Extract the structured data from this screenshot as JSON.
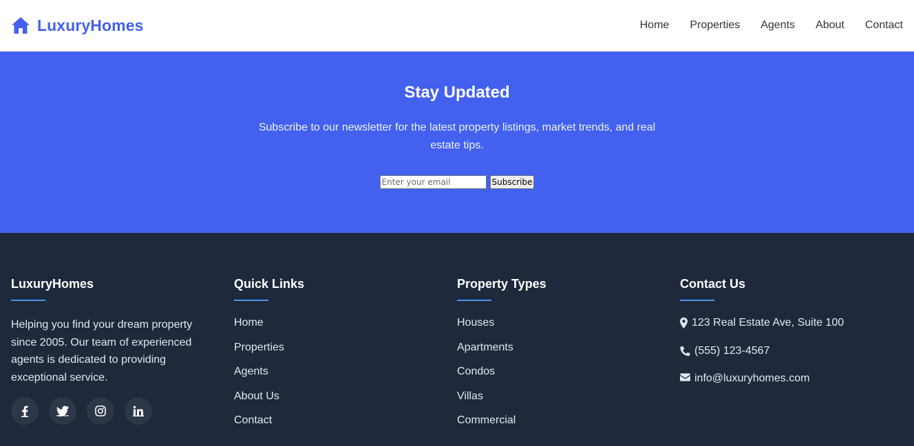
{
  "header": {
    "brand": "LuxuryHomes",
    "brand_icon": "home-icon",
    "brand_color": "#4361ee",
    "nav": [
      "Home",
      "Properties",
      "Agents",
      "About",
      "Contact"
    ]
  },
  "newsletter": {
    "title": "Stay Updated",
    "description": "Subscribe to our newsletter for the latest property listings, market trends, and real estate tips.",
    "email_placeholder": "Enter your email",
    "email_value": "",
    "button_label": "Subscribe",
    "background": "#4361ee"
  },
  "footer": {
    "background": "#1e293b",
    "accent": "#4895ef",
    "about": {
      "title": "LuxuryHomes",
      "text": "Helping you find your dream property since 2005. Our team of experienced agents is dedicated to providing exceptional service.",
      "social": [
        "facebook-icon",
        "twitter-icon",
        "instagram-icon",
        "linkedin-icon"
      ]
    },
    "quick_links": {
      "title": "Quick Links",
      "items": [
        "Home",
        "Properties",
        "Agents",
        "About Us",
        "Contact"
      ]
    },
    "property_types": {
      "title": "Property Types",
      "items": [
        "Houses",
        "Apartments",
        "Condos",
        "Villas",
        "Commercial"
      ]
    },
    "contact": {
      "title": "Contact Us",
      "address": "123 Real Estate Ave, Suite 100",
      "phone": "(555) 123-4567",
      "email": "info@luxuryhomes.com"
    }
  }
}
